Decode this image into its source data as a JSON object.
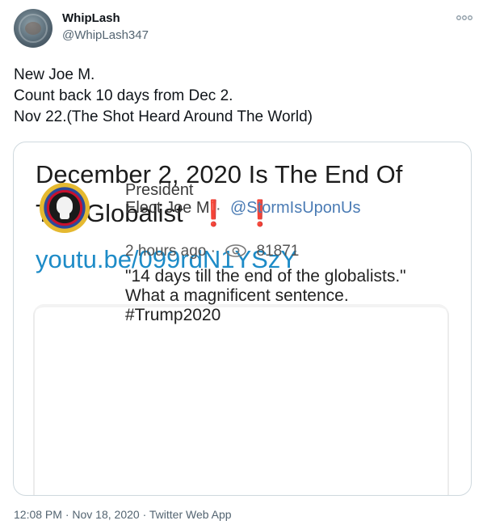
{
  "author": {
    "name": "WhipLash",
    "handle": "@WhipLash347",
    "avatar_icon": "avatar-image"
  },
  "tweet": {
    "lines": [
      "New Joe M.",
      "Count back 10 days from Dec 2.",
      "Nov 22.(The Shot Heard Around The World)"
    ]
  },
  "media": {
    "title_line1": "December 2, 2020 Is The End Of",
    "title_line2": "The Globalist",
    "exclamations": [
      "❗",
      "❗"
    ],
    "link": "youtu.be/099rdN1YSzY",
    "inner_post": {
      "name": "President Elect Joe M",
      "separator": "·",
      "handle": "@StormIsUponUs",
      "time": "2 hours ago",
      "meta_separator": "·",
      "views": "81871",
      "quote": "\"14 days till the end of the globalists.\" What a magnificent sentence. #Trump2020"
    }
  },
  "meta": {
    "time": "12:08 PM",
    "sep1": " · ",
    "date": "Nov 18, 2020",
    "sep2": " · ",
    "source": "Twitter Web App"
  },
  "colors": {
    "link_blue": "#1d8bc7",
    "exclamation_red": "#e0201b",
    "meta_gray": "#536471",
    "border": "#cfd9de"
  }
}
